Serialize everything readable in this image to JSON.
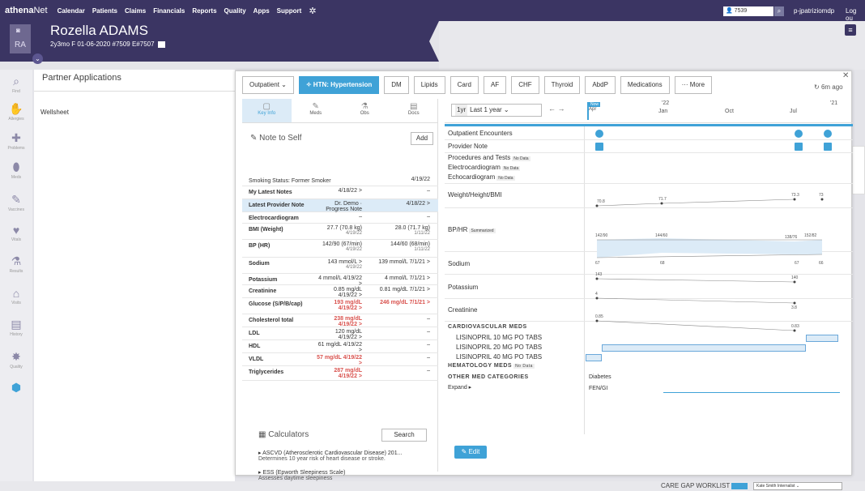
{
  "topnav": {
    "logo_a": "athena",
    "logo_b": "Net",
    "items": [
      "Calendar",
      "Patients",
      "Claims",
      "Financials",
      "Reports",
      "Quality",
      "Apps",
      "Support"
    ],
    "search_value": "7539",
    "user": "p-jpatriziomdp",
    "logout": "Log ou"
  },
  "patient": {
    "initials": "RA",
    "name": "Rozella ADAMS",
    "info": "2y3mo F  01-06-2020  #7509  E#7507"
  },
  "sidebar": [
    "Find",
    "Allergies",
    "Problems",
    "Meds",
    "Vaccines",
    "Vitals",
    "Results",
    "Visits",
    "History",
    "Quality"
  ],
  "partner": {
    "title": "Partner Applications",
    "item": "Wellsheet"
  },
  "tabs": [
    "Outpatient",
    "HTN: Hypertension",
    "DM",
    "Lipids",
    "Card",
    "AF",
    "CHF",
    "Thyroid",
    "AbdP",
    "Medications",
    "··· More"
  ],
  "refresh": "6m ago",
  "left_tabs": [
    "Key Info",
    "Meds",
    "Obs",
    "Docs"
  ],
  "note": {
    "label": "Note to Self",
    "add": "Add"
  },
  "rows": [
    {
      "k": "Smoking Status: Former Smoker",
      "v1": "",
      "d1": "",
      "v2": "4/19/22",
      "d2": ""
    },
    {
      "k": "My Latest Notes",
      "v1": "4/18/22 >",
      "d1": "",
      "v2": "–",
      "d2": ""
    },
    {
      "k": "Latest Provider Note",
      "v1": "Dr. Demo · Progress Note",
      "d1": "",
      "v2": "4/18/22 >",
      "d2": ""
    },
    {
      "k": "Electrocardiogram",
      "v1": "–",
      "d1": "",
      "v2": "–",
      "d2": ""
    },
    {
      "k": "BMI (Weight)",
      "v1": "27.7 (70.8 kg)",
      "d1": "4/19/22",
      "v2": "28.0 (71.7 kg)",
      "d2": "1/11/22"
    },
    {
      "k": "BP (HR)",
      "v1": "142/90 (67/min)",
      "d1": "4/19/22",
      "v2": "144/60 (68/min)",
      "d2": "1/11/22"
    },
    {
      "k": "Sodium",
      "v1": "143 mmol/L >",
      "d1": "4/19/22",
      "v2": "139 mmol/L 7/1/21 >",
      "d2": ""
    },
    {
      "k": "Potassium",
      "v1": "4 mmol/L 4/19/22 >",
      "d1": "",
      "v2": "4 mmol/L 7/1/21 >",
      "d2": ""
    },
    {
      "k": "Creatinine",
      "v1": "0.85 mg/dL 4/19/22 >",
      "d1": "",
      "v2": "0.81 mg/dL 7/1/21 >",
      "d2": ""
    },
    {
      "k": "Glucose (S/P/B/cap)",
      "v1": "193 mg/dL 4/19/22 >",
      "d1": "",
      "v2": "246 mg/dL 7/1/21 >",
      "d2": ""
    },
    {
      "k": "Cholesterol total",
      "v1": "238 mg/dL 4/19/22 >",
      "d1": "",
      "v2": "–",
      "d2": ""
    },
    {
      "k": "LDL",
      "v1": "120 mg/dL 4/19/22 >",
      "d1": "",
      "v2": "–",
      "d2": ""
    },
    {
      "k": "HDL",
      "v1": "61 mg/dL 4/19/22 >",
      "d1": "",
      "v2": "–",
      "d2": ""
    },
    {
      "k": "VLDL",
      "v1": "57 mg/dL 4/19/22 >",
      "d1": "",
      "v2": "–",
      "d2": ""
    },
    {
      "k": "Triglycerides",
      "v1": "287 mg/dL 4/19/22 >",
      "d1": "",
      "v2": "–",
      "d2": ""
    }
  ],
  "calc": {
    "title": "Calculators",
    "search": "Search",
    "items": [
      {
        "t": "ASCVD (Atherosclerotic Cardiovascular Disease) 201...",
        "s": "Determines 10 year risk of heart disease or stroke."
      },
      {
        "t": "ESS (Epworth Sleepiness Scale)",
        "s": "Assesses daytime sleepiness"
      }
    ]
  },
  "timeline": {
    "yr": "1yr",
    "period": "Last 1 year",
    "now": "Now",
    "ticks": [
      "Apr",
      "'22",
      "Jan",
      "Oct",
      "Jul",
      "'21"
    ]
  },
  "right_rows": [
    "Outpatient Encounters",
    "Provider Note",
    "Procedures and Tests",
    "Electrocardiogram",
    "Echocardiogram",
    "Weight/Height/BMI",
    "BP/HR",
    "Sodium",
    "Potassium",
    "Creatinine"
  ],
  "no_data": "No Data",
  "summarized": "Summarized",
  "meds": {
    "cardio": "CARDIOVASCULAR MEDS",
    "items": [
      "LISINOPRIL 10 MG PO TABS",
      "LISINOPRIL 20 MG PO TABS",
      "LISINOPRIL 40 MG PO TABS"
    ],
    "hema": "HEMATOLOGY MEDS",
    "other": "OTHER MED CATEGORIES",
    "expand": "Expand ▸",
    "cats": [
      "Diabetes",
      "FEN/GI"
    ]
  },
  "values": {
    "wt": [
      "70.8",
      "71.7",
      "73.3",
      "73"
    ],
    "bp": [
      "142/90",
      "144/60",
      "138/76",
      "152/82"
    ],
    "hr": [
      "67",
      "68",
      "67",
      "66"
    ],
    "na": [
      "143",
      "140"
    ],
    "k": [
      "4",
      "3.8"
    ],
    "cr": [
      "0.85",
      "0.83"
    ]
  },
  "edit": "Edit",
  "bottom": {
    "caregap": "CARE GAP WORKLIST",
    "kate": "Kate Smith Internalist"
  },
  "colors": {
    "nav": "#3b3563",
    "accent": "#3fa2d7",
    "alert": "#d9534f"
  }
}
